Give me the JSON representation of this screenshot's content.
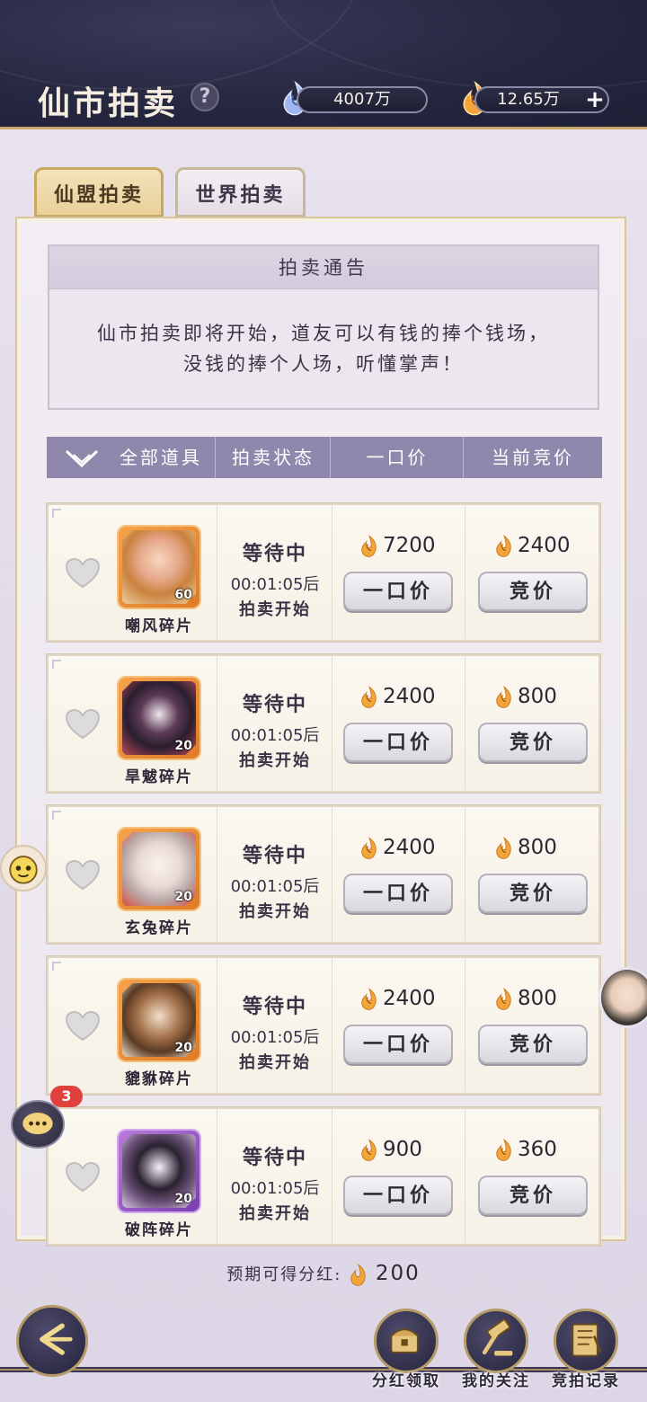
{
  "header": {
    "title": "仙市拍卖",
    "help_icon": "question-mark",
    "jade_amount": "4007万",
    "gold_amount": "12.65万",
    "plus_label": "+"
  },
  "tabs": [
    {
      "label": "仙盟拍卖",
      "active": true
    },
    {
      "label": "世界拍卖",
      "active": false
    }
  ],
  "notice": {
    "title": "拍卖通告",
    "line1": "仙市拍卖即将开始，道友可以有钱的捧个钱场，",
    "line2": "没钱的捧个人场，听懂掌声！"
  },
  "columns": {
    "filter": "全部道具",
    "status": "拍卖状态",
    "buyout": "一口价",
    "current_bid": "当前竞价"
  },
  "items": [
    {
      "name": "嘲风碎片",
      "count": "60",
      "rarity": "orange",
      "status": "等待中",
      "timer": "00:01:05后",
      "status_suffix": "拍卖开始",
      "buyout_price": "7200",
      "bid_price": "2400",
      "buyout_label": "一口价",
      "bid_label": "竞价"
    },
    {
      "name": "旱魃碎片",
      "count": "20",
      "rarity": "orange",
      "status": "等待中",
      "timer": "00:01:05后",
      "status_suffix": "拍卖开始",
      "buyout_price": "2400",
      "bid_price": "800",
      "buyout_label": "一口价",
      "bid_label": "竞价"
    },
    {
      "name": "玄兔碎片",
      "count": "20",
      "rarity": "orange",
      "status": "等待中",
      "timer": "00:01:05后",
      "status_suffix": "拍卖开始",
      "buyout_price": "2400",
      "bid_price": "800",
      "buyout_label": "一口价",
      "bid_label": "竞价"
    },
    {
      "name": "貔貅碎片",
      "count": "20",
      "rarity": "orange",
      "status": "等待中",
      "timer": "00:01:05后",
      "status_suffix": "拍卖开始",
      "buyout_price": "2400",
      "bid_price": "800",
      "buyout_label": "一口价",
      "bid_label": "竞价"
    },
    {
      "name": "破阵碎片",
      "count": "20",
      "rarity": "purple",
      "status": "等待中",
      "timer": "00:01:05后",
      "status_suffix": "拍卖开始",
      "buyout_price": "900",
      "bid_price": "360",
      "buyout_label": "一口价",
      "bid_label": "竞价"
    }
  ],
  "footer": {
    "dividend_label": "预期可得分红:",
    "dividend_amount": "200"
  },
  "chat_badge": "3",
  "nav": [
    {
      "label": "分红领取",
      "icon": "chest-icon"
    },
    {
      "label": "我的关注",
      "icon": "hammer-icon"
    },
    {
      "label": "竞拍记录",
      "icon": "record-icon"
    }
  ],
  "colors": {
    "header_bg": "#262740",
    "column_header": "#8f87ac",
    "gold_accent": "#c8a86a",
    "orange_frame": "#e07a26",
    "purple_frame": "#7a3fb0"
  }
}
